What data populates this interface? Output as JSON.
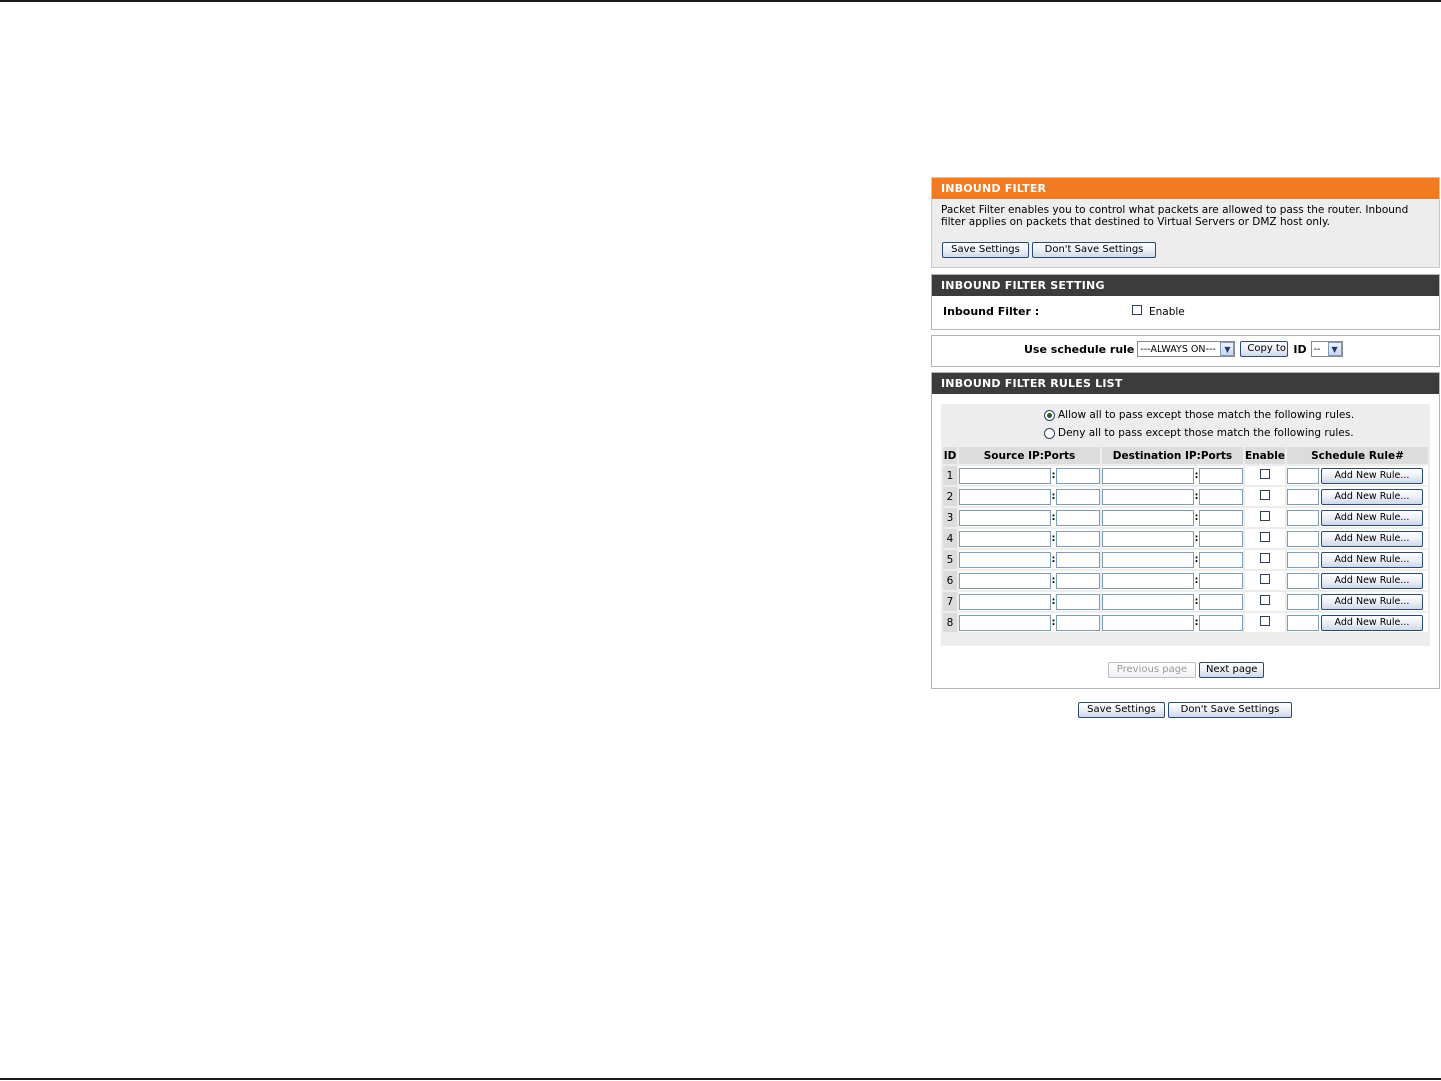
{
  "inbound_filter": {
    "title": "INBOUND FILTER",
    "description": "Packet Filter enables you to control what packets are allowed to pass the router. Inbound filter applies on packets that destined to Virtual Servers or DMZ host only.",
    "save_label": "Save Settings",
    "dont_save_label": "Don't Save Settings"
  },
  "setting": {
    "title": "INBOUND FILTER SETTING",
    "label": "Inbound Filter :",
    "enable_label": "Enable",
    "enabled": false
  },
  "schedule": {
    "label": "Use schedule rule",
    "selected": "---ALWAYS ON---",
    "copy_label": "Copy to",
    "id_label": "ID",
    "id_selected": "--"
  },
  "rules": {
    "title": "INBOUND FILTER RULES LIST",
    "options": [
      {
        "label": "Allow all to pass except those match the following rules.",
        "selected": true
      },
      {
        "label": "Deny all to pass except those match the following rules.",
        "selected": false
      }
    ],
    "columns": {
      "id": "ID",
      "source": "Source IP:Ports",
      "destination": "Destination IP:Ports",
      "enable": "Enable",
      "schedule": "Schedule Rule#"
    },
    "rows": [
      {
        "id": "1",
        "button": "Add New Rule..."
      },
      {
        "id": "2",
        "button": "Add New Rule..."
      },
      {
        "id": "3",
        "button": "Add New Rule..."
      },
      {
        "id": "4",
        "button": "Add New Rule..."
      },
      {
        "id": "5",
        "button": "Add New Rule..."
      },
      {
        "id": "6",
        "button": "Add New Rule..."
      },
      {
        "id": "7",
        "button": "Add New Rule..."
      },
      {
        "id": "8",
        "button": "Add New Rule..."
      }
    ],
    "prev_label": "Previous page",
    "next_label": "Next page"
  },
  "footer": {
    "save_label": "Save Settings",
    "dont_save_label": "Don't Save Settings"
  },
  "colors": {
    "header_orange": "#f27a20",
    "header_dark": "#3c3c3c",
    "panel_gray": "#ededed"
  }
}
